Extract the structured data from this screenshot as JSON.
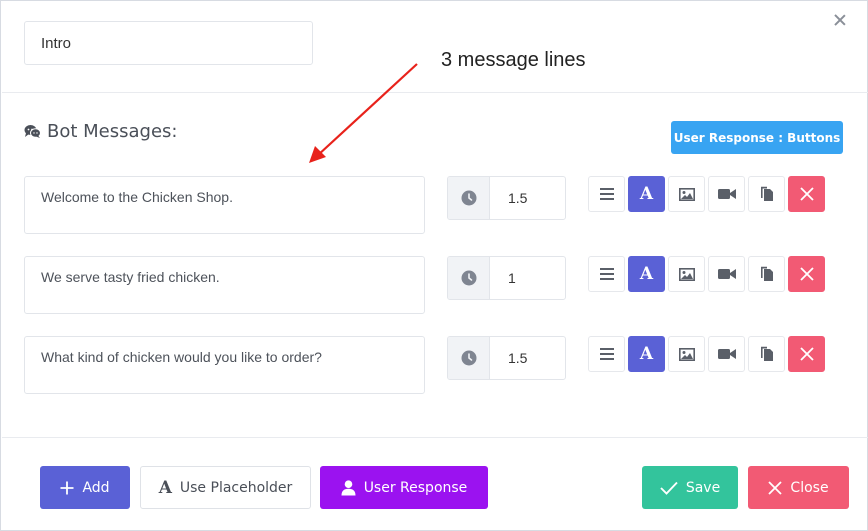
{
  "dialog": {
    "title_value": "Intro"
  },
  "annotation": {
    "text": "3 message lines"
  },
  "section": {
    "title": "Bot Messages:",
    "icon": "chat-bubbles-icon"
  },
  "user_response_buttons_label": "User Response : Buttons",
  "messages": [
    {
      "text": "Welcome to the Chicken Shop.",
      "delay": "1.5"
    },
    {
      "text": "We serve tasty fried chicken.",
      "delay": "1"
    },
    {
      "text": "What kind of chicken would you like to order?",
      "delay": "1.5"
    }
  ],
  "row_tools": [
    "menu-icon",
    "text-icon",
    "image-icon",
    "video-icon",
    "copy-icon",
    "delete-icon"
  ],
  "footer": {
    "add_label": "Add",
    "placeholder_label": "Use Placeholder",
    "user_response_label": "User Response",
    "save_label": "Save",
    "close_label": "Close"
  },
  "colors": {
    "primary": "#5a61d6",
    "info": "#38a4f2",
    "purple": "#9b12f0",
    "success": "#33c49c",
    "danger": "#f25a74",
    "annotation_arrow": "#e8221b"
  }
}
